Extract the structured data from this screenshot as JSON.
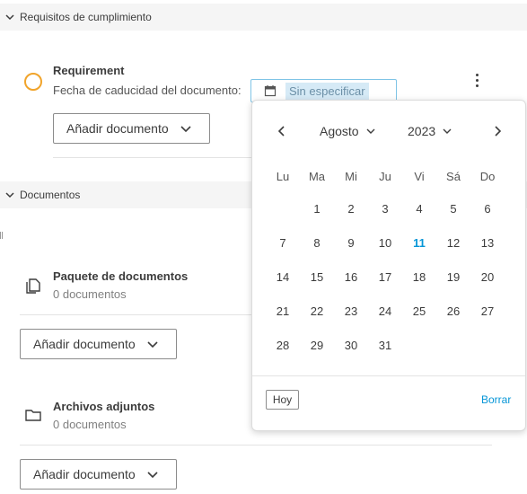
{
  "sections": {
    "requirements_header": "Requisitos de cumplimiento",
    "documents_header": "Documentos"
  },
  "requirement": {
    "title": "Requirement",
    "expiry_label": "Fecha de caducidad del documento:",
    "date_placeholder": "Sin especificar",
    "status_color": "#f1a42b",
    "add_button": "Añadir documento"
  },
  "documents": {
    "package": {
      "title": "Paquete de documentos",
      "count": "0 documentos",
      "icon": "documents-stack-icon",
      "add_button": "Añadir documento"
    },
    "attachments": {
      "title": "Archivos adjuntos",
      "count": "0 documentos",
      "icon": "folder-icon",
      "add_button": "Añadir documento"
    }
  },
  "calendar": {
    "month": "Agosto",
    "year": "2023",
    "weekdays": [
      "Lu",
      "Ma",
      "Mi",
      "Ju",
      "Vi",
      "Sá",
      "Do"
    ],
    "weeks": [
      [
        "",
        "1",
        "2",
        "3",
        "4",
        "5",
        "6"
      ],
      [
        "7",
        "8",
        "9",
        "10",
        "11",
        "12",
        "13"
      ],
      [
        "14",
        "15",
        "16",
        "17",
        "18",
        "19",
        "20"
      ],
      [
        "21",
        "22",
        "23",
        "24",
        "25",
        "26",
        "27"
      ],
      [
        "28",
        "29",
        "30",
        "31",
        "",
        "",
        ""
      ]
    ],
    "today": "11",
    "today_button": "Hoy",
    "clear_button": "Borrar",
    "accent_color": "#0696d7"
  }
}
